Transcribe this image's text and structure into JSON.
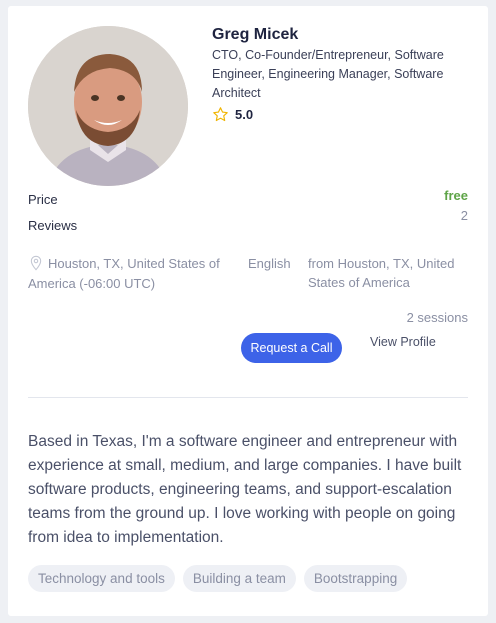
{
  "mentor": {
    "name": "Greg Micek",
    "title": "CTO, Co-Founder/Entrepreneur, Software Engineer, Engineering Manager, Software Architect",
    "rating": "5.0",
    "price_label": "Price",
    "price_value": "free",
    "reviews_label": "Reviews",
    "reviews_value": "2",
    "location": "Houston, TX, United States of America (-06:00 UTC)",
    "language": "English",
    "from": "from Houston, TX, United States of America",
    "sessions": "2 sessions",
    "bio": "Based in Texas, I'm a software engineer and entrepreneur with experience at small, medium, and large companies. I have built software products, engineering teams, and support-escalation teams from the ground up. I love working with people on going from idea to implementation."
  },
  "actions": {
    "request_label": "Request a Call",
    "view_label": "View Profile"
  },
  "tags": [
    "Technology and tools",
    "Building a team",
    "Bootstrapping"
  ],
  "icons": {
    "rating": "star-icon",
    "location": "location-pin-icon"
  },
  "colors": {
    "accent": "#3d63e8",
    "price": "#5ea447",
    "star": "#f0b400"
  }
}
